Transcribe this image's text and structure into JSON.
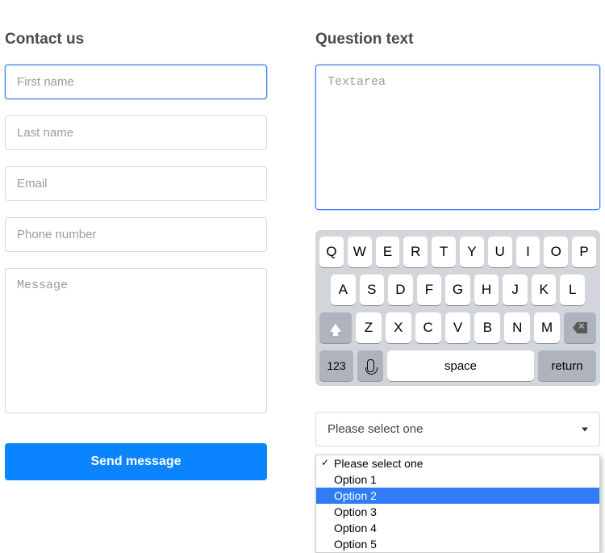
{
  "contact": {
    "heading": "Contact us",
    "first_name_placeholder": "First name",
    "last_name_placeholder": "Last name",
    "email_placeholder": "Email",
    "phone_placeholder": "Phone number",
    "message_placeholder": "Message",
    "submit_label": "Send message"
  },
  "question": {
    "heading": "Question text",
    "textarea_placeholder": "Textarea"
  },
  "keyboard": {
    "row1": [
      "Q",
      "W",
      "E",
      "R",
      "T",
      "Y",
      "U",
      "I",
      "O",
      "P"
    ],
    "row2": [
      "A",
      "S",
      "D",
      "F",
      "G",
      "H",
      "J",
      "K",
      "L"
    ],
    "row3": [
      "Z",
      "X",
      "C",
      "V",
      "B",
      "N",
      "M"
    ],
    "num_label": "123",
    "space_label": "space",
    "return_label": "return"
  },
  "select": {
    "placeholder": "Please select one",
    "options": [
      {
        "label": "Please select one",
        "checked": true,
        "highlight": false
      },
      {
        "label": "Option 1",
        "checked": false,
        "highlight": false
      },
      {
        "label": "Option 2",
        "checked": false,
        "highlight": true
      },
      {
        "label": "Option 3",
        "checked": false,
        "highlight": false
      },
      {
        "label": "Option 4",
        "checked": false,
        "highlight": false
      },
      {
        "label": "Option 5",
        "checked": false,
        "highlight": false
      }
    ]
  }
}
